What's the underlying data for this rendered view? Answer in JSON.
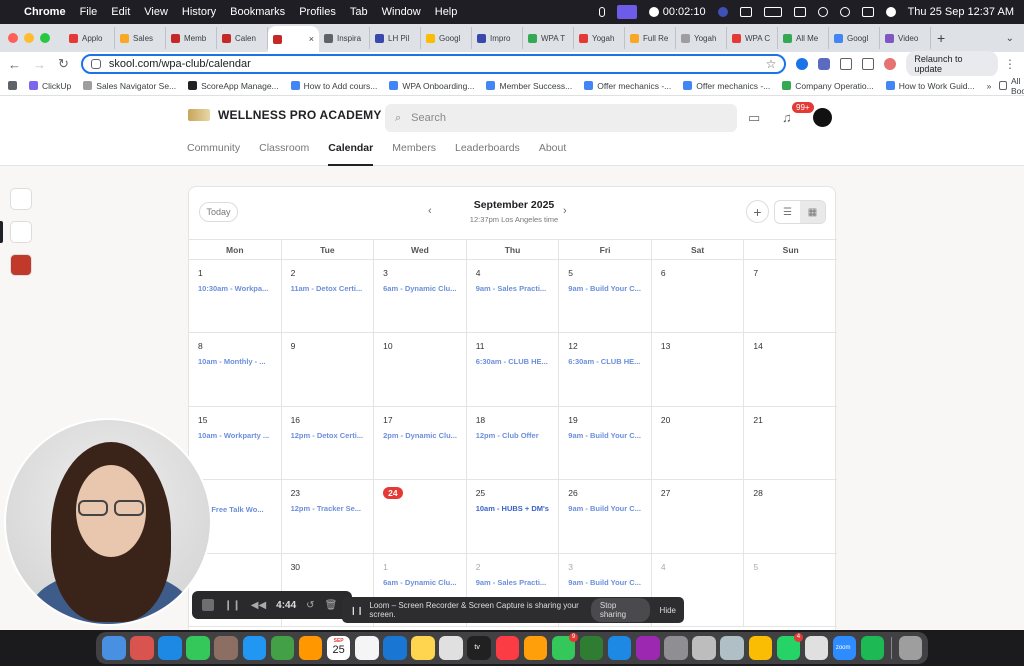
{
  "menubar": {
    "app": "Chrome",
    "items": [
      "File",
      "Edit",
      "View",
      "History",
      "Bookmarks",
      "Profiles",
      "Tab",
      "Window",
      "Help"
    ],
    "timer": "00:02:10",
    "clock": "Thu 25 Sep  12:37 AM"
  },
  "tabs": [
    {
      "label": "Applo",
      "color": "#e53935"
    },
    {
      "label": "Sales",
      "color": "#f9a825"
    },
    {
      "label": "Memb",
      "color": "#c62828"
    },
    {
      "label": "Calen",
      "color": "#c62828"
    },
    {
      "label": "",
      "color": "#c62828",
      "active": true
    },
    {
      "label": "Inspira",
      "color": "#5f6368"
    },
    {
      "label": "LH Pil",
      "color": "#3949ab"
    },
    {
      "label": "Googl",
      "color": "#fbbc04"
    },
    {
      "label": "Impro",
      "color": "#3949ab"
    },
    {
      "label": "WPA T",
      "color": "#34a853"
    },
    {
      "label": "Yogah",
      "color": "#e53935"
    },
    {
      "label": "Full Re",
      "color": "#f9a825"
    },
    {
      "label": "Yogah",
      "color": "#9e9e9e"
    },
    {
      "label": "WPA C",
      "color": "#e53935"
    },
    {
      "label": "All Me",
      "color": "#34a853"
    },
    {
      "label": "Googl",
      "color": "#4285f4"
    },
    {
      "label": "Video",
      "color": "#7e57c2"
    }
  ],
  "toolbar": {
    "url": "skool.com/wpa-club/calendar",
    "relaunch": "Relaunch to update"
  },
  "bookmarks": [
    {
      "label": "",
      "color": "#5f6368"
    },
    {
      "label": "ClickUp",
      "color": "#7b68ee"
    },
    {
      "label": "Sales Navigator Se...",
      "color": "#9e9e9e"
    },
    {
      "label": "ScoreApp Manage...",
      "color": "#202124"
    },
    {
      "label": "How to Add cours...",
      "color": "#4285f4"
    },
    {
      "label": "WPA Onboarding...",
      "color": "#4285f4"
    },
    {
      "label": "Member Success...",
      "color": "#4285f4"
    },
    {
      "label": "Offer mechanics -...",
      "color": "#4285f4"
    },
    {
      "label": "Offer mechanics -...",
      "color": "#4285f4"
    },
    {
      "label": "Company Operatio...",
      "color": "#34a853"
    },
    {
      "label": "How to Work Guid...",
      "color": "#4285f4"
    }
  ],
  "bookmarks_more": "»",
  "all_bookmarks": "All Bookmarks",
  "site": {
    "name": "WELLNESS PRO ACADEMY",
    "search_placeholder": "Search",
    "notif_count": "99+",
    "nav": [
      {
        "label": "Community"
      },
      {
        "label": "Classroom"
      },
      {
        "label": "Calendar",
        "active": true
      },
      {
        "label": "Members"
      },
      {
        "label": "Leaderboards"
      },
      {
        "label": "About"
      }
    ]
  },
  "calendar": {
    "today_label": "Today",
    "month": "September 2025",
    "time_note": "12:37pm Los Angeles time",
    "weekdays": [
      "Mon",
      "Tue",
      "Wed",
      "Thu",
      "Fri",
      "Sat",
      "Sun"
    ],
    "weeks": [
      [
        {
          "day": "1",
          "event": "10:30am - Workpa..."
        },
        {
          "day": "2",
          "event": "11am - Detox Certi..."
        },
        {
          "day": "3",
          "event": "6am - Dynamic Clu..."
        },
        {
          "day": "4",
          "event": "9am - Sales Practi..."
        },
        {
          "day": "5",
          "event": "9am - Build Your C..."
        },
        {
          "day": "6",
          "event": ""
        },
        {
          "day": "7",
          "event": ""
        }
      ],
      [
        {
          "day": "8",
          "event": "10am - Monthly - ..."
        },
        {
          "day": "9",
          "event": ""
        },
        {
          "day": "10",
          "event": ""
        },
        {
          "day": "11",
          "event": "6:30am - CLUB HE..."
        },
        {
          "day": "12",
          "event": "6:30am - CLUB HE..."
        },
        {
          "day": "13",
          "event": ""
        },
        {
          "day": "14",
          "event": ""
        }
      ],
      [
        {
          "day": "15",
          "event": "10am - Workparty ..."
        },
        {
          "day": "16",
          "event": "12pm - Detox Certi..."
        },
        {
          "day": "17",
          "event": "2pm - Dynamic Clu..."
        },
        {
          "day": "18",
          "event": "12pm - Club Offer"
        },
        {
          "day": "19",
          "event": "9am - Build Your C..."
        },
        {
          "day": "20",
          "event": ""
        },
        {
          "day": "21",
          "event": ""
        }
      ],
      [
        {
          "day": "",
          "event": "m - Free Talk Wo..."
        },
        {
          "day": "23",
          "event": "12pm - Tracker Se..."
        },
        {
          "day": "24",
          "event": "",
          "today": true
        },
        {
          "day": "25",
          "event": "10am - HUBS + DM's",
          "strong": true
        },
        {
          "day": "26",
          "event": "9am - Build Your C..."
        },
        {
          "day": "27",
          "event": ""
        },
        {
          "day": "28",
          "event": ""
        }
      ],
      [
        {
          "day": "",
          "event": ""
        },
        {
          "day": "30",
          "event": ""
        },
        {
          "day": "1",
          "event": "6am - Dynamic Clu...",
          "muted": true
        },
        {
          "day": "2",
          "event": "9am - Sales Practi...",
          "muted": true
        },
        {
          "day": "3",
          "event": "9am - Build Your C...",
          "muted": true
        },
        {
          "day": "4",
          "event": "",
          "muted": true
        },
        {
          "day": "5",
          "event": "",
          "muted": true
        }
      ]
    ]
  },
  "loom": {
    "time": "4:44",
    "share_message": "Loom – Screen Recorder & Screen Capture is sharing your screen.",
    "stop_sharing": "Stop sharing",
    "hide": "Hide"
  },
  "dock": {
    "icons": [
      {
        "name": "finder",
        "color": "#4a90e2"
      },
      {
        "name": "launchpad",
        "color": "#d9534f"
      },
      {
        "name": "safari",
        "color": "#1e88e5"
      },
      {
        "name": "messages",
        "color": "#34c759"
      },
      {
        "name": "notes-brown",
        "color": "#8d6e63"
      },
      {
        "name": "mail",
        "color": "#2196f3"
      },
      {
        "name": "maps",
        "color": "#43a047"
      },
      {
        "name": "photos",
        "color": "#ff9800"
      },
      {
        "name": "calendar",
        "color": "#ffffff"
      },
      {
        "name": "reminders",
        "color": "#f5f5f5"
      },
      {
        "name": "keynote",
        "color": "#1976d2"
      },
      {
        "name": "notes",
        "color": "#ffd54f"
      },
      {
        "name": "freeform",
        "color": "#e0e0e0"
      },
      {
        "name": "tv",
        "color": "#212121"
      },
      {
        "name": "music",
        "color": "#fc3c44"
      },
      {
        "name": "pages",
        "color": "#ff9f0a"
      },
      {
        "name": "facetime",
        "color": "#34c759",
        "badge": "9"
      },
      {
        "name": "numbers",
        "color": "#2e7d32"
      },
      {
        "name": "app-store",
        "color": "#1e88e5"
      },
      {
        "name": "podcasts",
        "color": "#9c27b0"
      },
      {
        "name": "settings",
        "color": "#8e8e93"
      },
      {
        "name": "scripts",
        "color": "#bdbdbd"
      },
      {
        "name": "preview",
        "color": "#b0bec5"
      },
      {
        "name": "chrome",
        "color": "#fbbc04"
      },
      {
        "name": "whatsapp",
        "color": "#25d366",
        "badge": "4"
      },
      {
        "name": "loom",
        "color": "#e0e0e0"
      },
      {
        "name": "zoom",
        "color": "#2d8cff"
      },
      {
        "name": "spotify",
        "color": "#1db954"
      },
      {
        "name": "trash",
        "color": "#9e9e9e"
      }
    ],
    "calendar_day": "25",
    "calendar_month": "SEP",
    "zoom_label": "zoom",
    "tv_label": "tv"
  }
}
